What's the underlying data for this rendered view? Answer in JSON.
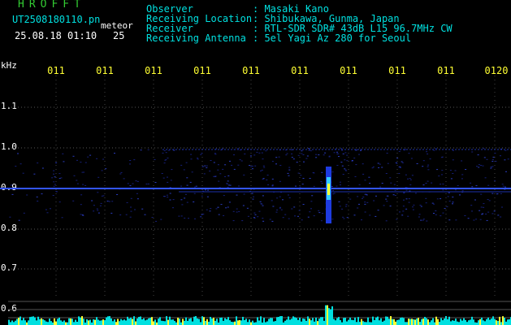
{
  "app": {
    "brand": "HROFFT",
    "filename": "UT2508180110.pn",
    "datetime": "25.08.18 01:10",
    "meteor_label": "meteor",
    "meteor_count": "25"
  },
  "header": {
    "rows": [
      {
        "label": "Observer",
        "value": ": Masaki Kano"
      },
      {
        "label": "Receiving Location",
        "value": ": Shibukawa, Gunma, Japan"
      },
      {
        "label": "Receiver",
        "value": ": RTL-SDR SDR# 43dB L15 96.7MHz CW"
      },
      {
        "label": "Receiving Antenna",
        "value": ": 5el Yagi Az 280 for Seoul"
      }
    ]
  },
  "axis": {
    "unit": "kHz",
    "x_ticks": [
      "011",
      "011",
      "011",
      "011",
      "011",
      "011",
      "011",
      "011",
      "011",
      "0120"
    ],
    "y_ticks": [
      "1.1",
      "1.0",
      "0.9",
      "0.8",
      "0.7",
      "0.6"
    ]
  },
  "colors": {
    "brand": "#33cc33",
    "header_text": "#00e0e0",
    "info_text": "#ffffff",
    "tick_text": "#ffff33",
    "background": "#000000",
    "signal": "#3355ff",
    "meteor_core": "#ffff33"
  }
}
